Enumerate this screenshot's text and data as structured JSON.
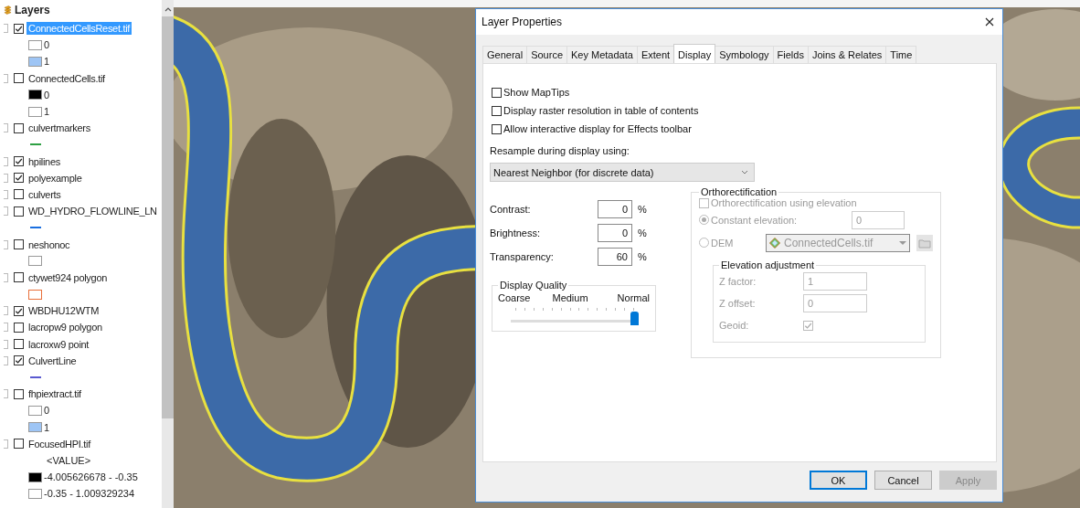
{
  "toc": {
    "title": "Layers",
    "layers": [
      {
        "name": "ConnectedCellsReset.tif",
        "checked": true,
        "selected": true,
        "legend": [
          {
            "kind": "swatch",
            "color": "#ffffff",
            "label": "0"
          },
          {
            "kind": "swatch",
            "color": "#9ec5f5",
            "label": "1"
          }
        ]
      },
      {
        "name": "ConnectedCells.tif",
        "checked": false,
        "selected": false,
        "legend": [
          {
            "kind": "swatch",
            "color": "#000000",
            "label": "0"
          },
          {
            "kind": "swatch",
            "color": "#ffffff",
            "label": "1"
          }
        ]
      },
      {
        "name": "culvertmarkers",
        "checked": false,
        "selected": false,
        "legend": [
          {
            "kind": "line",
            "color": "#2ea043"
          }
        ]
      },
      {
        "name": "hpilines",
        "checked": true,
        "selected": false
      },
      {
        "name": "polyexample",
        "checked": true,
        "selected": false
      },
      {
        "name": "culverts",
        "checked": false,
        "selected": false
      },
      {
        "name": "WD_HYDRO_FLOWLINE_LN",
        "checked": false,
        "selected": false,
        "legend": [
          {
            "kind": "line",
            "color": "#1a6fe0"
          }
        ]
      },
      {
        "name": "neshonoc",
        "checked": false,
        "selected": false,
        "legend": [
          {
            "kind": "outline",
            "color": "#9a9a9a"
          }
        ]
      },
      {
        "name": "ctywet924 polygon",
        "checked": false,
        "selected": false,
        "legend": [
          {
            "kind": "outline",
            "color": "#e8703a"
          }
        ]
      },
      {
        "name": "WBDHU12WTM",
        "checked": true,
        "selected": false
      },
      {
        "name": "lacropw9 polygon",
        "checked": false,
        "selected": false
      },
      {
        "name": "lacroxw9 point",
        "checked": false,
        "selected": false
      },
      {
        "name": "CulvertLine",
        "checked": true,
        "selected": false,
        "legend": [
          {
            "kind": "line",
            "color": "#5a5ad0"
          }
        ]
      },
      {
        "name": "fhpiextract.tif",
        "checked": false,
        "selected": false,
        "legend": [
          {
            "kind": "swatch",
            "color": "#ffffff",
            "label": "0"
          },
          {
            "kind": "swatch",
            "color": "#9ec5f5",
            "label": "1"
          }
        ]
      },
      {
        "name": "FocusedHPI.tif",
        "checked": false,
        "selected": false,
        "legend": [
          {
            "kind": "heading",
            "label": "<VALUE>"
          },
          {
            "kind": "swatch",
            "color": "#000000",
            "label": "-4.005626678 - -0.35"
          },
          {
            "kind": "swatch",
            "color": "#ffffff",
            "label": "-0.35 - 1.009329234"
          }
        ]
      }
    ]
  },
  "dialog": {
    "title": "Layer Properties",
    "tabs": [
      {
        "label": "General",
        "selected": false
      },
      {
        "label": "Source",
        "selected": false
      },
      {
        "label": "Key Metadata",
        "selected": false
      },
      {
        "label": "Extent",
        "selected": false
      },
      {
        "label": "Display",
        "selected": true
      },
      {
        "label": "Symbology",
        "selected": false
      },
      {
        "label": "Fields",
        "selected": false
      },
      {
        "label": "Joins & Relates",
        "selected": false
      },
      {
        "label": "Time",
        "selected": false
      }
    ],
    "options": [
      {
        "label": "Show MapTips",
        "checked": false
      },
      {
        "label": "Display raster resolution in table of contents",
        "checked": false
      },
      {
        "label": "Allow interactive display for Effects toolbar",
        "checked": false
      }
    ],
    "resample": {
      "label": "Resample during display using:",
      "value": "Nearest Neighbor (for discrete data)"
    },
    "adjustments": [
      {
        "label": "Contrast:",
        "value": "0",
        "unit": "%"
      },
      {
        "label": "Brightness:",
        "value": "0",
        "unit": "%"
      },
      {
        "label": "Transparency:",
        "value": "60",
        "unit": "%"
      }
    ],
    "display_quality": {
      "title": "Display Quality",
      "labels": [
        "Coarse",
        "Medium",
        "Normal"
      ],
      "level": 1
    },
    "orthorectification": {
      "title": "Orthorectification",
      "use_elevation": {
        "label": "Orthorectification using elevation",
        "checked": false,
        "disabled": true
      },
      "sources": [
        {
          "label": "Constant elevation:",
          "selected": true,
          "kind": "field",
          "value": "0"
        },
        {
          "label": "DEM",
          "selected": false,
          "kind": "dropdown",
          "value": "ConnectedCells.tif"
        }
      ],
      "elevation_adjustment": {
        "title": "Elevation adjustment",
        "fields": [
          {
            "label": "Z factor:",
            "value": "1"
          },
          {
            "label": "Z offset:",
            "value": "0"
          }
        ],
        "geoid": {
          "label": "Geoid:",
          "checked": true
        }
      }
    },
    "buttons": [
      {
        "label": "OK",
        "disabled": false,
        "default": true
      },
      {
        "label": "Cancel",
        "disabled": false,
        "default": false
      },
      {
        "label": "Apply",
        "disabled": true,
        "default": false
      }
    ]
  }
}
